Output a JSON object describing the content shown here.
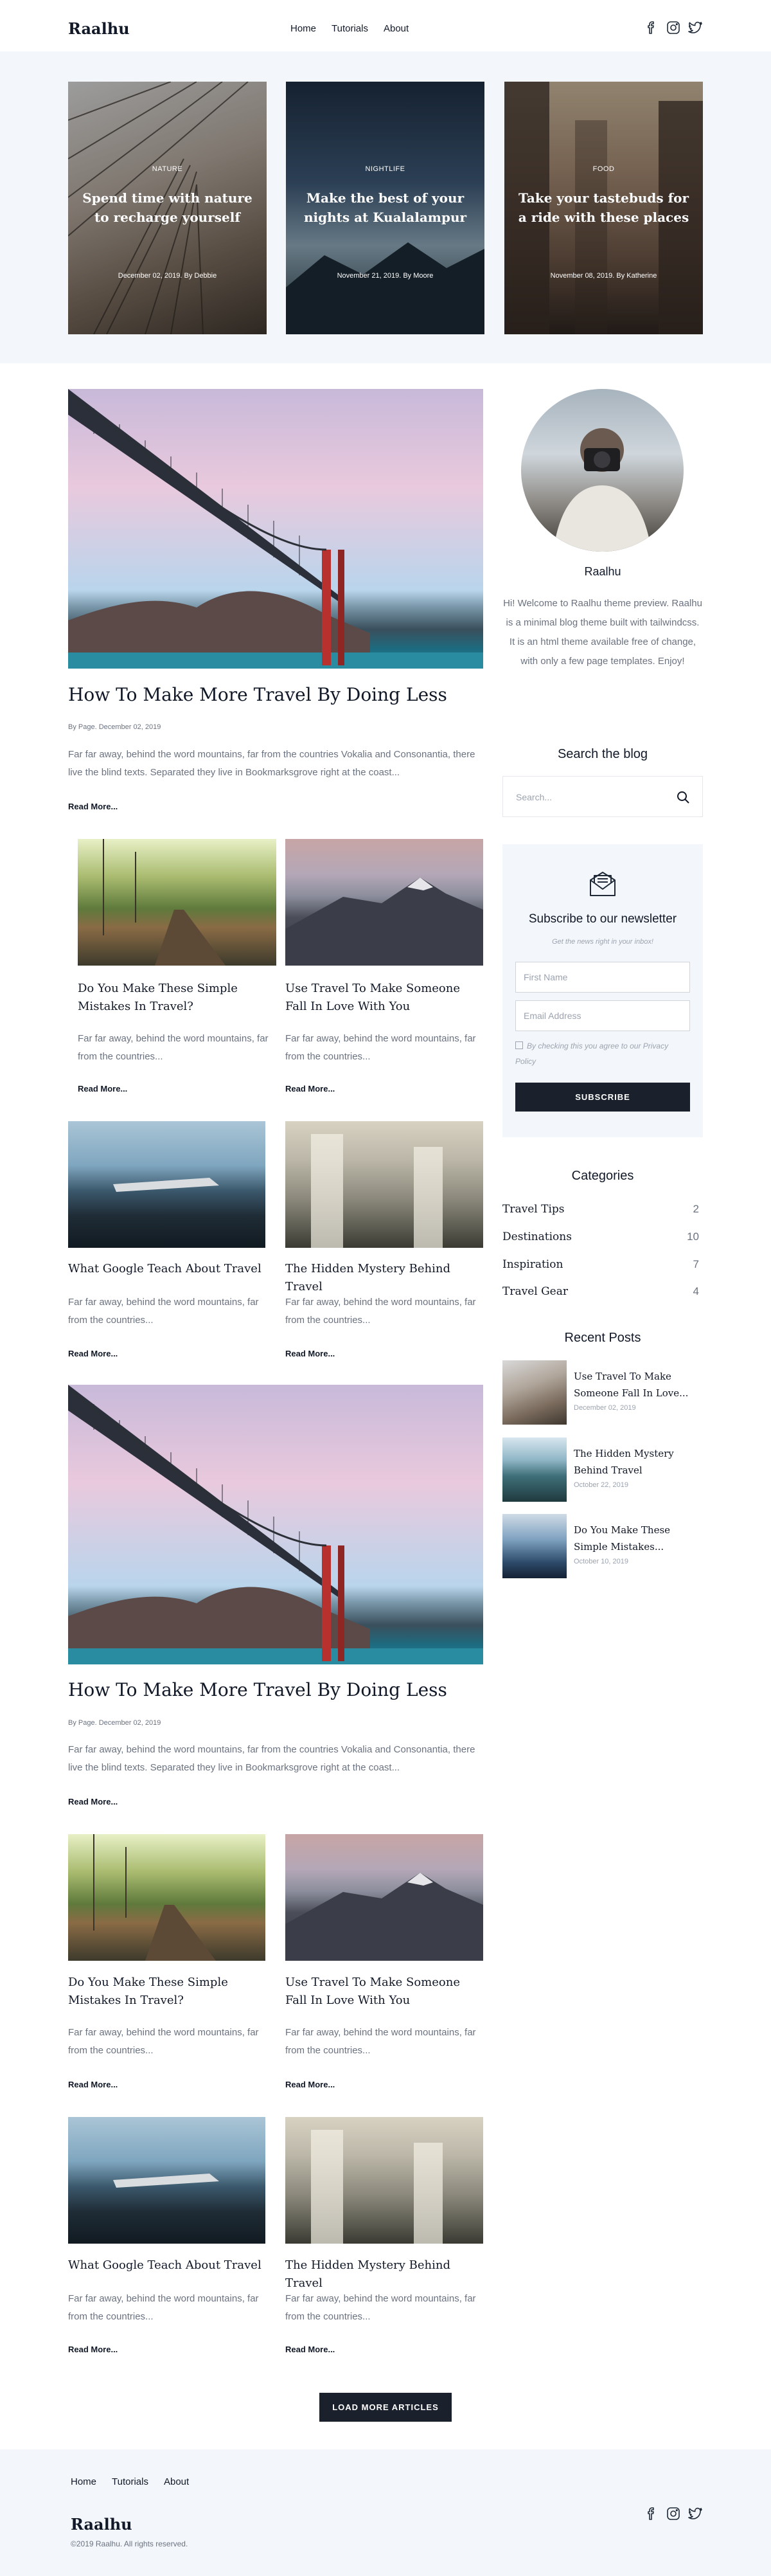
{
  "header": {
    "logo": "Raalhu",
    "nav": [
      "Home",
      "Tutorials",
      "About"
    ],
    "social_icons": [
      "facebook-icon",
      "instagram-icon",
      "twitter-icon"
    ]
  },
  "hero": [
    {
      "category": "NATURE",
      "title": "Spend time with nature to recharge yourself",
      "meta": "December 02, 2019. By Debbie"
    },
    {
      "category": "NIGHTLIFE",
      "title": "Make the best of your nights at Kualalampur",
      "meta": "November 21, 2019. By Moore"
    },
    {
      "category": "FOOD",
      "title": "Take your tastebuds for a ride with these places",
      "meta": "November 08, 2019. By Katherine"
    }
  ],
  "featured": [
    {
      "title": "How To Make More Travel By Doing Less",
      "meta": "By Page. December 02, 2019",
      "excerpt": "Far far away, behind the word mountains, far from the countries Vokalia and Consonantia, there live the blind texts. Separated they live in Bookmarksgrove right at the coast...",
      "read_more": "Read More..."
    },
    {
      "title": "How To Make More Travel By Doing Less",
      "meta": "By Page. December 02, 2019",
      "excerpt": "Far far away, behind the word mountains, far from the countries Vokalia and Consonantia, there live the blind texts. Separated they live in Bookmarksgrove right at the coast...",
      "read_more": "Read More..."
    }
  ],
  "grid_posts": [
    {
      "title": "Do You Make These Simple Mistakes In Travel?",
      "excerpt": "Far far away, behind the word mountains, far from the countries...",
      "read_more": "Read More..."
    },
    {
      "title": "Use Travel To Make Someone Fall In Love With You",
      "excerpt": "Far far away, behind the word mountains, far from the countries...",
      "read_more": "Read More..."
    },
    {
      "title": "What Google Teach About Travel",
      "excerpt": "Far far away, behind the word mountains, far from the countries...",
      "read_more": "Read More..."
    },
    {
      "title": "The Hidden Mystery Behind Travel",
      "excerpt": "Far far away, behind the word mountains, far from the countries...",
      "read_more": "Read More..."
    },
    {
      "title": "Do You Make These Simple Mistakes In Travel?",
      "excerpt": "Far far away, behind the word mountains, far from the countries...",
      "read_more": "Read More..."
    },
    {
      "title": "Use Travel To Make Someone Fall In Love With You",
      "excerpt": "Far far away, behind the word mountains, far from the countries...",
      "read_more": "Read More..."
    },
    {
      "title": "What Google Teach About Travel",
      "excerpt": "Far far away, behind the word mountains, far from the countries...",
      "read_more": "Read More..."
    },
    {
      "title": "The Hidden Mystery Behind Travel",
      "excerpt": "Far far away, behind the word mountains, far from the countries...",
      "read_more": "Read More..."
    }
  ],
  "sidebar": {
    "name": "Raalhu",
    "bio": "Hi! Welcome to Raalhu theme preview. Raalhu is a minimal blog theme built with tailwindcss. It is an html theme available free of change, with only a few page templates. Enjoy!",
    "search_heading": "Search the blog",
    "search_placeholder": "Search...",
    "newsletter": {
      "heading": "Subscribe to our newsletter",
      "subheading": "Get the news right in your inbox!",
      "first_name_placeholder": "First Name",
      "email_placeholder": "Email Address",
      "agree": "By checking this you agree to our Privacy Policy",
      "button": "SUBSCRIBE"
    },
    "categories_heading": "Categories",
    "categories": [
      {
        "name": "Travel Tips",
        "count": "2"
      },
      {
        "name": "Destinations",
        "count": "10"
      },
      {
        "name": "Inspiration",
        "count": "7"
      },
      {
        "name": "Travel Gear",
        "count": "4"
      }
    ],
    "recent_heading": "Recent Posts",
    "recent": [
      {
        "title": "Use Travel To Make Someone Fall In Love...",
        "date": "December 02, 2019"
      },
      {
        "title": "The Hidden Mystery Behind Travel",
        "date": "October 22, 2019"
      },
      {
        "title": "Do You Make These Simple Mistakes...",
        "date": "October 10, 2019"
      }
    ]
  },
  "load_more": "LOAD MORE ARTICLES",
  "footer": {
    "nav": [
      "Home",
      "Tutorials",
      "About"
    ],
    "logo": "Raalhu",
    "copyright": "©2019 Raalhu. All rights reserved."
  }
}
